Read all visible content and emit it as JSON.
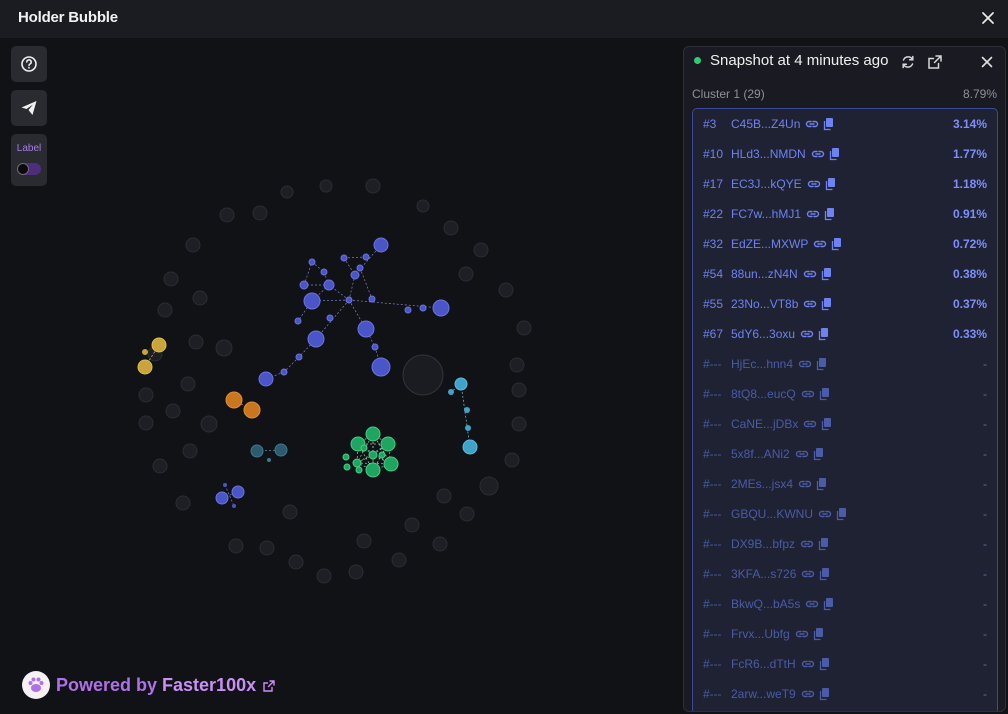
{
  "app": {
    "title": "Holder Bubble"
  },
  "tools": {
    "label_text": "Label"
  },
  "footer": {
    "powered_prefix": "Powered by ",
    "powered_brand": "Faster100x"
  },
  "panel": {
    "snapshot_text": "Snapshot at 4 minutes ago",
    "cluster_name": "Cluster 1 (29)",
    "cluster_pct": "8.79%",
    "rows": [
      {
        "rank": "#3",
        "address": "C45B...Z4Un",
        "pct": "3.14%",
        "active": true
      },
      {
        "rank": "#10",
        "address": "HLd3...NMDN",
        "pct": "1.77%",
        "active": true
      },
      {
        "rank": "#17",
        "address": "EC3J...kQYE",
        "pct": "1.18%",
        "active": true
      },
      {
        "rank": "#22",
        "address": "FC7w...hMJ1",
        "pct": "0.91%",
        "active": true
      },
      {
        "rank": "#32",
        "address": "EdZE...MXWP",
        "pct": "0.72%",
        "active": true
      },
      {
        "rank": "#54",
        "address": "88un...zN4N",
        "pct": "0.38%",
        "active": true
      },
      {
        "rank": "#55",
        "address": "23No...VT8b",
        "pct": "0.37%",
        "active": true
      },
      {
        "rank": "#67",
        "address": "5dY6...3oxu",
        "pct": "0.33%",
        "active": true
      },
      {
        "rank": "#---",
        "address": "HjEc...hnn4",
        "pct": "-",
        "active": false
      },
      {
        "rank": "#---",
        "address": "8tQ8...eucQ",
        "pct": "-",
        "active": false
      },
      {
        "rank": "#---",
        "address": "CaNE...jDBx",
        "pct": "-",
        "active": false
      },
      {
        "rank": "#---",
        "address": "5x8f...ANi2",
        "pct": "-",
        "active": false
      },
      {
        "rank": "#---",
        "address": "2MEs...jsx4",
        "pct": "-",
        "active": false
      },
      {
        "rank": "#---",
        "address": "GBQU...KWNU",
        "pct": "-",
        "active": false
      },
      {
        "rank": "#---",
        "address": "DX9B...bfpz",
        "pct": "-",
        "active": false
      },
      {
        "rank": "#---",
        "address": "3KFA...s726",
        "pct": "-",
        "active": false
      },
      {
        "rank": "#---",
        "address": "BkwQ...bA5s",
        "pct": "-",
        "active": false
      },
      {
        "rank": "#---",
        "address": "Frvx...Ubfg",
        "pct": "-",
        "active": false
      },
      {
        "rank": "#---",
        "address": "FcR6...dTtH",
        "pct": "-",
        "active": false
      },
      {
        "rank": "#---",
        "address": "2arw...weT9",
        "pct": "-",
        "active": false
      }
    ]
  },
  "colors": {
    "accent_purple": "#b070e8",
    "cluster_blue": "#4a55c8",
    "cluster_green": "#1fa560",
    "cluster_orange": "#c9761e",
    "cluster_yellow": "#c9a43a",
    "cluster_cyan": "#3fa2c9",
    "status_green": "#2ecc71"
  },
  "icons": {
    "close": "close-icon",
    "help": "question-circle-icon",
    "telegram": "send-icon",
    "refresh": "refresh-icon",
    "external": "external-link-icon",
    "link": "link-icon",
    "copy": "copy-icon",
    "paw": "paw-icon"
  }
}
